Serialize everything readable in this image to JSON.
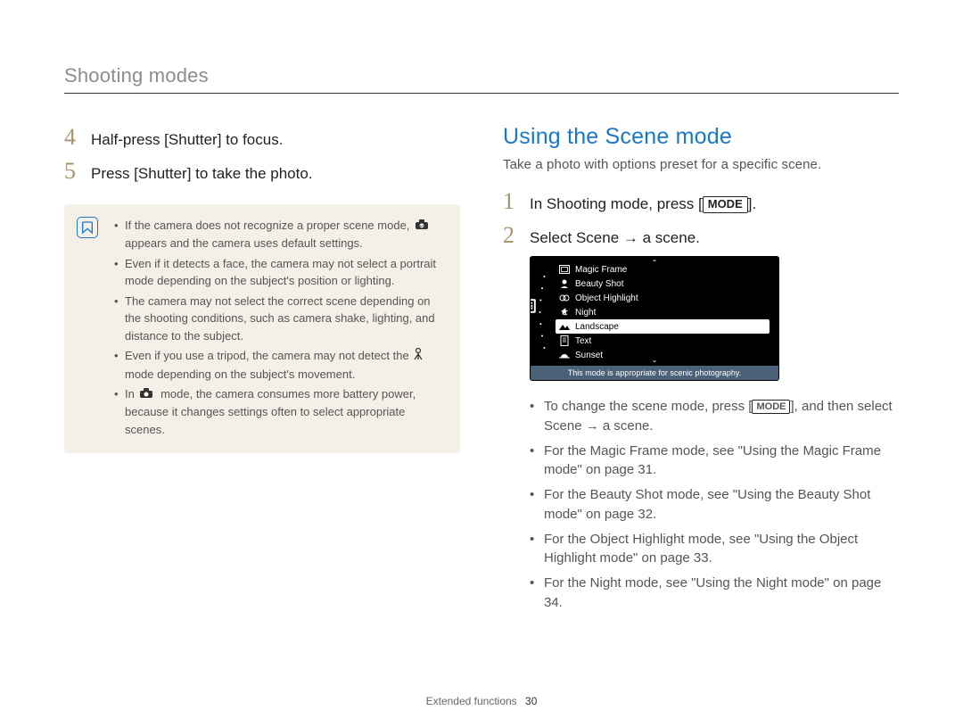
{
  "header": {
    "title": "Shooting modes"
  },
  "left": {
    "steps": [
      {
        "num": "4",
        "text": "Half-press [Shutter] to focus."
      },
      {
        "num": "5",
        "text": "Press [Shutter] to take the photo."
      }
    ],
    "note": {
      "items": [
        {
          "pre": "If the camera does not recognize a proper scene mode, ",
          "icon": "smart-icon",
          "post": " appears and the camera uses default settings."
        },
        {
          "pre": "Even if it detects a face, the camera may not select a portrait mode depending on the subject's position or lighting."
        },
        {
          "pre": "The camera may not select the correct scene depending on the shooting conditions, such as camera shake, lighting, and distance to the subject."
        },
        {
          "pre": "Even if you use a tripod, the camera may not detect the ",
          "icon": "tripod-icon",
          "post": " mode depending on the subject's movement."
        },
        {
          "pre": "In ",
          "icon": "smart-auto-icon",
          "post": " mode, the camera consumes more battery power, because it changes settings often to select appropriate scenes."
        }
      ]
    }
  },
  "right": {
    "heading": "Using the Scene mode",
    "sub": "Take a photo with options preset for a specific scene.",
    "steps": [
      {
        "num": "1",
        "pre": "In Shooting mode, press [",
        "mode": "MODE",
        "post": "]."
      },
      {
        "num": "2",
        "pre": "Select Scene → a scene."
      }
    ],
    "scene_screenshot": {
      "left_label": "SCENE",
      "items": [
        {
          "icon": "magic-frame-icon",
          "label": "Magic Frame"
        },
        {
          "icon": "beauty-shot-icon",
          "label": "Beauty Shot"
        },
        {
          "icon": "object-highlight-icon",
          "label": "Object Highlight"
        },
        {
          "icon": "night-icon",
          "label": "Night"
        },
        {
          "icon": "landscape-icon",
          "label": "Landscape",
          "selected": true
        },
        {
          "icon": "text-icon",
          "label": "Text"
        },
        {
          "icon": "sunset-icon",
          "label": "Sunset"
        }
      ],
      "footer": "This mode is appropriate for scenic photography."
    },
    "bullets": [
      {
        "pre": "To change the scene mode, press [",
        "mode": "MODE",
        "post": "], and then select Scene → a scene."
      },
      {
        "pre": "For the Magic Frame mode, see \"Using the Magic Frame mode\" on page 31."
      },
      {
        "pre": "For the Beauty Shot mode, see \"Using the Beauty Shot mode\" on page 32."
      },
      {
        "pre": "For the Object Highlight mode, see \"Using the Object Highlight mode\" on page 33."
      },
      {
        "pre": "For the Night mode, see \"Using the Night mode\" on page 34."
      }
    ]
  },
  "footer": {
    "section": "Extended functions",
    "page": "30"
  }
}
